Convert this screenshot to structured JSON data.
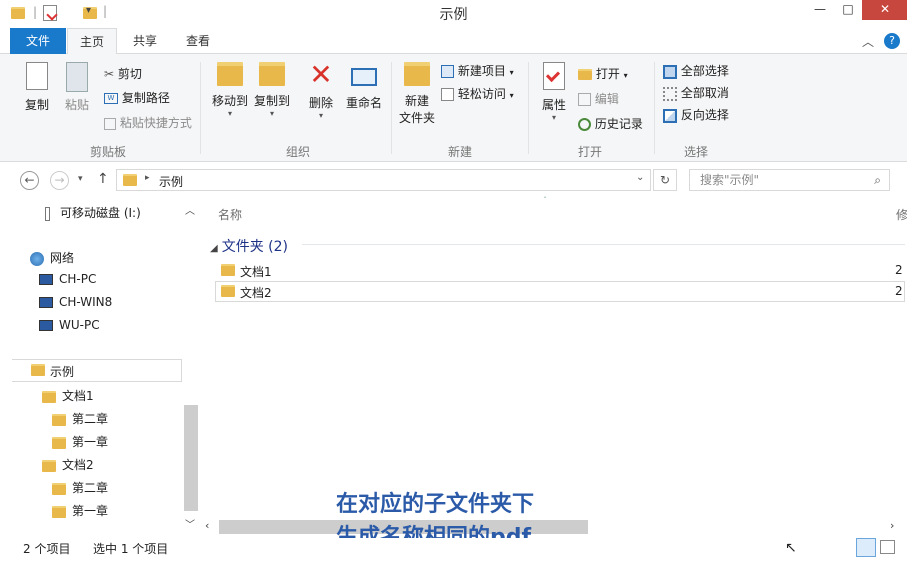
{
  "window": {
    "title": "示例",
    "controls": [
      "—",
      "□",
      "✕"
    ]
  },
  "tabs": {
    "file": "文件",
    "home": "主页",
    "share": "共享",
    "view": "查看"
  },
  "ribbon": {
    "clipboard": {
      "copy": "复制",
      "paste": "粘贴",
      "cut": "剪切",
      "copy_path": "复制路径",
      "paste_shortcut": "粘贴快捷方式",
      "group": "剪贴板"
    },
    "organize": {
      "move_to": "移动到",
      "copy_to": "复制到",
      "delete": "删除",
      "rename": "重命名",
      "group": "组织"
    },
    "new": {
      "new_folder_line1": "新建",
      "new_folder_line2": "文件夹",
      "new_item": "新建项目",
      "easy_access": "轻松访问",
      "group": "新建"
    },
    "open": {
      "properties": "属性",
      "open": "打开",
      "edit": "编辑",
      "history": "历史记录",
      "group": "打开"
    },
    "select": {
      "select_all": "全部选择",
      "select_none": "全部取消",
      "invert": "反向选择",
      "group": "选择"
    }
  },
  "address": {
    "crumb": "示例",
    "search_placeholder": "搜索\"示例\""
  },
  "tree": {
    "removable": "可移动磁盘 (I:)",
    "network": "网络",
    "pcs": [
      "CH-PC",
      "CH-WIN8",
      "WU-PC"
    ],
    "example": "示例",
    "doc1": "文档1",
    "doc1_children": [
      "第二章",
      "第一章"
    ],
    "doc2": "文档2",
    "doc2_children": [
      "第二章",
      "第一章"
    ]
  },
  "content": {
    "column_name": "名称",
    "column_cut": "修",
    "group_header": "文件夹 (2)",
    "items": [
      {
        "name": "文档1",
        "date": "2"
      },
      {
        "name": "文档2",
        "date": "2"
      }
    ]
  },
  "status": {
    "count": "2 个项目",
    "selected": "选中 1 个项目"
  },
  "caption": {
    "line1": "在对应的子文件夹下",
    "line2": "生成名称相同的pdf"
  },
  "colors": {
    "accent": "#1979ca",
    "caption": "#2a5aa8",
    "close": "#c7463e",
    "folder": "#e8b84a"
  }
}
